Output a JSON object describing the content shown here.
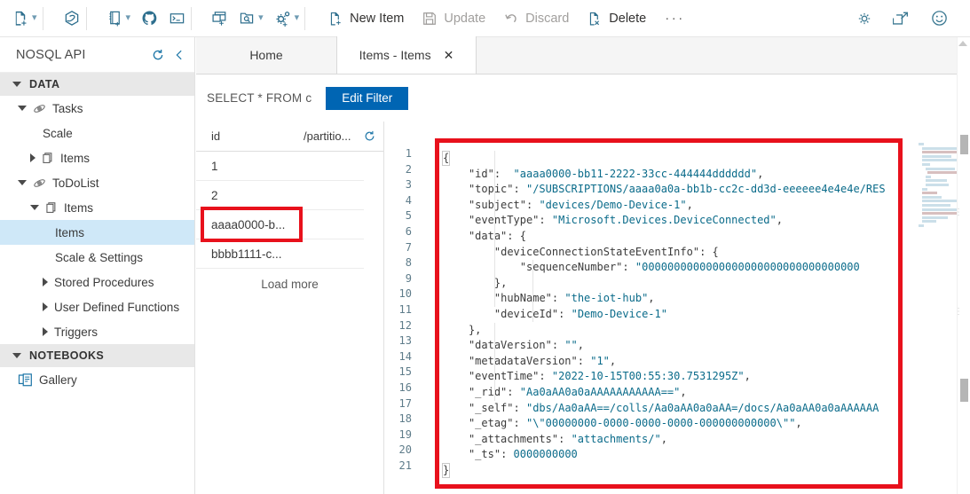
{
  "toolbar": {
    "icons_left": [
      {
        "name": "new-container-icon",
        "has_chevron": true
      },
      {
        "name": "cosmos-db-icon",
        "has_chevron": false
      },
      {
        "name": "new-notebook-icon",
        "has_chevron": true
      },
      {
        "name": "github-icon",
        "has_chevron": false
      },
      {
        "name": "terminal-icon",
        "has_chevron": false
      },
      {
        "name": "new-sql-query-icon",
        "has_chevron": false
      },
      {
        "name": "open-query-icon",
        "has_chevron": true
      },
      {
        "name": "settings-plus-icon",
        "has_chevron": true
      }
    ],
    "commands": [
      {
        "label": "New Item",
        "icon": "new-item-icon",
        "disabled": false
      },
      {
        "label": "Update",
        "icon": "save-icon",
        "disabled": true
      },
      {
        "label": "Discard",
        "icon": "undo-icon",
        "disabled": true
      },
      {
        "label": "Delete",
        "icon": "delete-item-icon",
        "disabled": false
      }
    ],
    "overflow_label": "···",
    "icons_right": [
      {
        "name": "gear-icon"
      },
      {
        "name": "open-in-new-icon"
      },
      {
        "name": "feedback-smiley-icon"
      }
    ]
  },
  "sidebar": {
    "title": "NOSQL API",
    "refresh_icon": "refresh-icon",
    "collapse_icon": "chevron-left-icon",
    "sections": [
      {
        "label": "DATA",
        "expanded": true,
        "items": [
          {
            "label": "Tasks",
            "icon": "database-icon",
            "indent": 1,
            "expanded": true,
            "twisty": "down",
            "selected": false
          },
          {
            "label": "Scale",
            "icon": "none",
            "indent": 3,
            "twisty": "none",
            "selected": false
          },
          {
            "label": "Items",
            "icon": "container-icon",
            "indent": 2,
            "twisty": "right",
            "selected": false
          },
          {
            "label": "ToDoList",
            "icon": "database-icon",
            "indent": 1,
            "expanded": true,
            "twisty": "down",
            "selected": false
          },
          {
            "label": "Items",
            "icon": "container-icon",
            "indent": 2,
            "twisty": "down",
            "selected": false
          },
          {
            "label": "Items",
            "icon": "none",
            "indent": 4,
            "twisty": "none",
            "selected": true
          },
          {
            "label": "Scale & Settings",
            "icon": "none",
            "indent": 4,
            "twisty": "none",
            "selected": false
          },
          {
            "label": "Stored Procedures",
            "icon": "none",
            "indent": 3,
            "twisty": "right",
            "selected": false
          },
          {
            "label": "User Defined Functions",
            "icon": "none",
            "indent": 3,
            "twisty": "right",
            "selected": false
          },
          {
            "label": "Triggers",
            "icon": "none",
            "indent": 3,
            "twisty": "right",
            "selected": false
          }
        ]
      },
      {
        "label": "NOTEBOOKS",
        "expanded": true,
        "items": [
          {
            "label": "Gallery",
            "icon": "gallery-icon",
            "indent": 1,
            "twisty": "none",
            "selected": false
          }
        ]
      }
    ]
  },
  "tabs": [
    {
      "label": "Home",
      "active": false,
      "closable": false
    },
    {
      "label": "Items - Items",
      "active": true,
      "closable": true,
      "close_label": "✕"
    }
  ],
  "filter_bar": {
    "query_text": "SELECT * FROM c",
    "edit_filter_label": "Edit Filter"
  },
  "item_list": {
    "columns": [
      "id",
      "/partitio..."
    ],
    "refresh_icon": "refresh-icon",
    "rows": [
      {
        "id": "1",
        "highlighted": false
      },
      {
        "id": "2",
        "highlighted": false
      },
      {
        "id": "aaaa0000-b...",
        "highlighted": true
      },
      {
        "id": "bbbb1111-c...",
        "highlighted": false
      }
    ],
    "load_more_label": "Load more"
  },
  "editor": {
    "highlight_color": "#e8111c",
    "line_numbers": [
      "1",
      "2",
      "3",
      "4",
      "5",
      "6",
      "7",
      "8",
      "9",
      "10",
      "11",
      "12",
      "13",
      "14",
      "15",
      "16",
      "17",
      "18",
      "19",
      "20",
      "21"
    ],
    "lines": [
      "{",
      "    \"id\":  \"aaaa0000-bb11-2222-33cc-444444dddddd\",",
      "    \"topic\": \"/SUBSCRIPTIONS/aaaa0a0a-bb1b-cc2c-dd3d-eeeeee4e4e4e/RES",
      "    \"subject\": \"devices/Demo-Device-1\",",
      "    \"eventType\": \"Microsoft.Devices.DeviceConnected\",",
      "    \"data\": {",
      "        \"deviceConnectionStateEventInfo\": {",
      "            \"sequenceNumber\": \"0000000000000000000000000000000000",
      "        },",
      "        \"hubName\": \"the-iot-hub\",",
      "        \"deviceId\": \"Demo-Device-1\"",
      "    },",
      "    \"dataVersion\": \"\",",
      "    \"metadataVersion\": \"1\",",
      "    \"eventTime\": \"2022-10-15T00:55:30.7531295Z\",",
      "    \"_rid\": \"Aa0aAA0a0aAAAAAAAAAAA==\",",
      "    \"_self\": \"dbs/Aa0aAA==/colls/Aa0aAA0a0aAA=/docs/Aa0aAA0a0aAAAAAA",
      "    \"_etag\": \"\\\"00000000-0000-0000-0000-000000000000\\\"\",",
      "    \"_attachments\": \"attachments/\",",
      "    \"_ts\": 0000000000",
      "}"
    ]
  }
}
